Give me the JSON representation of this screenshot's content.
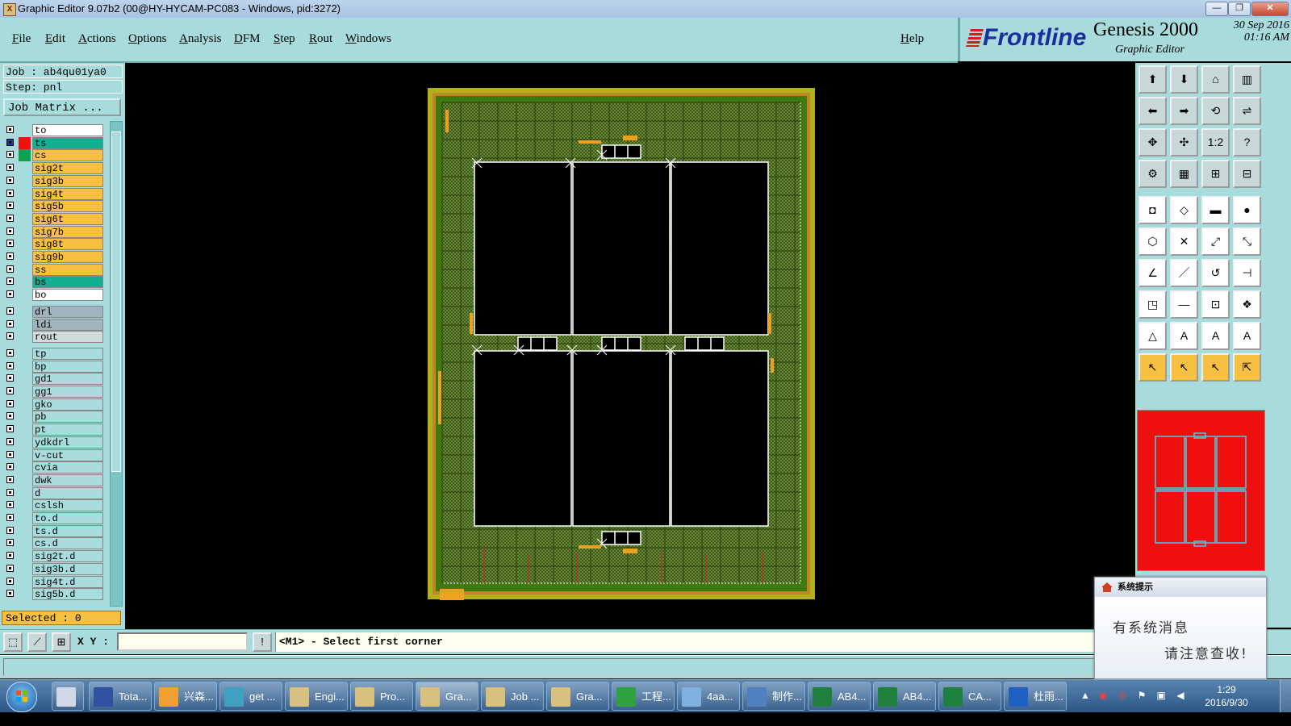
{
  "window": {
    "title": "Graphic Editor 9.07b2 (00@HY-HYCAM-PC083 - Windows, pid:3272)",
    "minimize_glyph": "—",
    "maximize_glyph": "❐",
    "close_glyph": "✕"
  },
  "menu": {
    "items": [
      "File",
      "Edit",
      "Actions",
      "Options",
      "Analysis",
      "DFM",
      "Step",
      "Rout",
      "Windows"
    ],
    "help": "Help"
  },
  "brand": {
    "logo": "Frontline",
    "product": "Genesis 2000",
    "subtitle": "Graphic Editor",
    "date": "30  Sep  2016",
    "time": "01:16  AM"
  },
  "job": {
    "job_label": "Job : ab4qu01ya0",
    "step_label": "Step: pnl",
    "matrix_button": "Job Matrix ..."
  },
  "layers": [
    {
      "name": "to",
      "color": "#ffffff",
      "swatch": "",
      "group": 1
    },
    {
      "name": "ts",
      "color": "#10b090",
      "swatch": "#f01010",
      "group": 1,
      "active": true
    },
    {
      "name": "cs",
      "color": "#f8c040",
      "swatch": "#10a050",
      "group": 1
    },
    {
      "name": "sig2t",
      "color": "#f8c040",
      "swatch": "",
      "group": 1
    },
    {
      "name": "sig3b",
      "color": "#f8c040",
      "swatch": "",
      "group": 1
    },
    {
      "name": "sig4t",
      "color": "#f8c040",
      "swatch": "",
      "group": 1
    },
    {
      "name": "sig5b",
      "color": "#f8c040",
      "swatch": "",
      "group": 1
    },
    {
      "name": "sig6t",
      "color": "#f8c040",
      "swatch": "",
      "group": 1
    },
    {
      "name": "sig7b",
      "color": "#f8c040",
      "swatch": "",
      "group": 1
    },
    {
      "name": "sig8t",
      "color": "#f8c040",
      "swatch": "",
      "group": 1
    },
    {
      "name": "sig9b",
      "color": "#f8c040",
      "swatch": "",
      "group": 1
    },
    {
      "name": "ss",
      "color": "#f8c040",
      "swatch": "",
      "group": 1
    },
    {
      "name": "bs",
      "color": "#10b090",
      "swatch": "",
      "group": 1
    },
    {
      "name": "bo",
      "color": "#ffffff",
      "swatch": "",
      "group": 1
    },
    {
      "name": "drl",
      "color": "#a0b4c0",
      "swatch": "",
      "group": 2
    },
    {
      "name": "ldi",
      "color": "#a0b4c0",
      "swatch": "",
      "group": 2
    },
    {
      "name": "rout",
      "color": "#d0dcdc",
      "swatch": "",
      "group": 2
    },
    {
      "name": "tp",
      "color": "#a8dcdc",
      "swatch": "",
      "group": 3
    },
    {
      "name": "bp",
      "color": "#a8dcdc",
      "swatch": "",
      "group": 3
    },
    {
      "name": "gd1",
      "color": "#a8dcdc",
      "swatch": "",
      "group": 3
    },
    {
      "name": "gg1",
      "color": "#a8dcdc",
      "swatch": "",
      "group": 3
    },
    {
      "name": "gko",
      "color": "#a8dcdc",
      "swatch": "",
      "group": 3
    },
    {
      "name": "pb",
      "color": "#a8dcdc",
      "swatch": "",
      "group": 3
    },
    {
      "name": "pt",
      "color": "#a8dcdc",
      "swatch": "",
      "group": 3
    },
    {
      "name": "ydkdrl",
      "color": "#a8dcdc",
      "swatch": "",
      "group": 3
    },
    {
      "name": "v-cut",
      "color": "#a8dcdc",
      "swatch": "",
      "group": 3
    },
    {
      "name": "cvia",
      "color": "#a8dcdc",
      "swatch": "",
      "group": 3
    },
    {
      "name": "dwk",
      "color": "#a8dcdc",
      "swatch": "",
      "group": 3
    },
    {
      "name": "d",
      "color": "#a8dcdc",
      "swatch": "",
      "group": 3
    },
    {
      "name": "cslsh",
      "color": "#a8dcdc",
      "swatch": "",
      "group": 3
    },
    {
      "name": "to.d",
      "color": "#a8dcdc",
      "swatch": "",
      "group": 3
    },
    {
      "name": "ts.d",
      "color": "#a8dcdc",
      "swatch": "",
      "group": 3
    },
    {
      "name": "cs.d",
      "color": "#a8dcdc",
      "swatch": "",
      "group": 3
    },
    {
      "name": "sig2t.d",
      "color": "#a8dcdc",
      "swatch": "",
      "group": 3
    },
    {
      "name": "sig3b.d",
      "color": "#a8dcdc",
      "swatch": "",
      "group": 3
    },
    {
      "name": "sig4t.d",
      "color": "#a8dcdc",
      "swatch": "",
      "group": 3
    },
    {
      "name": "sig5b.d",
      "color": "#a8dcdc",
      "swatch": "",
      "group": 3
    }
  ],
  "selected_label": "Selected : 0",
  "toolbar": {
    "row_glyphs": [
      [
        "⬆",
        "⬇",
        "⌂",
        "▥"
      ],
      [
        "⬅",
        "➡",
        "⟲",
        "⇌"
      ],
      [
        "✥",
        "✣",
        "1:2",
        "?"
      ],
      [
        "⚙",
        "▦",
        "⊞",
        "⊟"
      ],
      [
        "◘",
        "◇",
        "▬",
        "●"
      ],
      [
        "⬡",
        "✕",
        "⤢",
        "⤡"
      ],
      [
        "∠",
        "／",
        "↺",
        "⊣"
      ],
      [
        "◳",
        "—",
        "⊡",
        "❖"
      ],
      [
        "△",
        "A",
        "A",
        "A"
      ],
      [
        "↖",
        "↖",
        "↖",
        "⇱"
      ]
    ],
    "orange_row": 9,
    "white_rows": [
      4,
      5,
      6,
      7,
      8
    ]
  },
  "command": {
    "xy_label": "X Y :",
    "xy_value": "",
    "info_glyph": "!",
    "prompt": "<M1> - Select first corner"
  },
  "notification": {
    "title": "系统提示",
    "line1": "有系统消息",
    "line2": "请注意查收!"
  },
  "taskbar": {
    "tasks": [
      {
        "label": "",
        "icon_color": "#d0d8e8"
      },
      {
        "label": "Tota...",
        "icon_color": "#3050a0"
      },
      {
        "label": "兴森...",
        "icon_color": "#f0a030"
      },
      {
        "label": "get ...",
        "icon_color": "#40a0c0"
      },
      {
        "label": "Engi...",
        "icon_color": "#d8c080"
      },
      {
        "label": "Pro...",
        "icon_color": "#d8c080"
      },
      {
        "label": "Gra...",
        "icon_color": "#d8c080",
        "active": true
      },
      {
        "label": "Job ...",
        "icon_color": "#d8c080"
      },
      {
        "label": "Gra...",
        "icon_color": "#d8c080"
      },
      {
        "label": "工程...",
        "icon_color": "#30a040"
      },
      {
        "label": "4aa...",
        "icon_color": "#80b0e0"
      },
      {
        "label": "制作...",
        "icon_color": "#5080c0"
      },
      {
        "label": "AB4...",
        "icon_color": "#208040"
      },
      {
        "label": "AB4...",
        "icon_color": "#208040"
      },
      {
        "label": "CA...",
        "icon_color": "#208040"
      },
      {
        "label": "杜雨...",
        "icon_color": "#2060c0"
      }
    ],
    "time": "1:29",
    "date": "2016/9/30"
  }
}
